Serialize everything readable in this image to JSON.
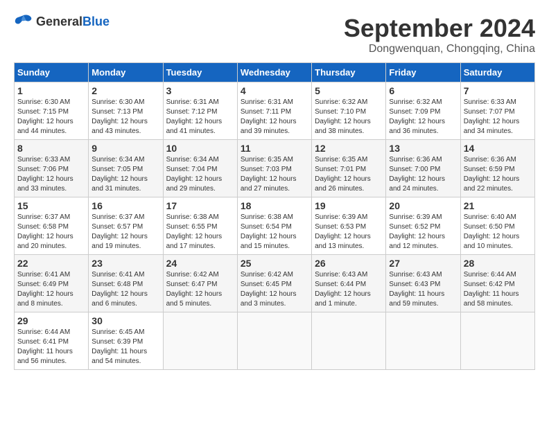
{
  "header": {
    "logo_general": "General",
    "logo_blue": "Blue",
    "month": "September 2024",
    "location": "Dongwenquan, Chongqing, China"
  },
  "days_of_week": [
    "Sunday",
    "Monday",
    "Tuesday",
    "Wednesday",
    "Thursday",
    "Friday",
    "Saturday"
  ],
  "weeks": [
    [
      {
        "day": "1",
        "sunrise": "6:30 AM",
        "sunset": "7:15 PM",
        "daylight": "12 hours and 44 minutes."
      },
      {
        "day": "2",
        "sunrise": "6:30 AM",
        "sunset": "7:13 PM",
        "daylight": "12 hours and 43 minutes."
      },
      {
        "day": "3",
        "sunrise": "6:31 AM",
        "sunset": "7:12 PM",
        "daylight": "12 hours and 41 minutes."
      },
      {
        "day": "4",
        "sunrise": "6:31 AM",
        "sunset": "7:11 PM",
        "daylight": "12 hours and 39 minutes."
      },
      {
        "day": "5",
        "sunrise": "6:32 AM",
        "sunset": "7:10 PM",
        "daylight": "12 hours and 38 minutes."
      },
      {
        "day": "6",
        "sunrise": "6:32 AM",
        "sunset": "7:09 PM",
        "daylight": "12 hours and 36 minutes."
      },
      {
        "day": "7",
        "sunrise": "6:33 AM",
        "sunset": "7:07 PM",
        "daylight": "12 hours and 34 minutes."
      }
    ],
    [
      {
        "day": "8",
        "sunrise": "6:33 AM",
        "sunset": "7:06 PM",
        "daylight": "12 hours and 33 minutes."
      },
      {
        "day": "9",
        "sunrise": "6:34 AM",
        "sunset": "7:05 PM",
        "daylight": "12 hours and 31 minutes."
      },
      {
        "day": "10",
        "sunrise": "6:34 AM",
        "sunset": "7:04 PM",
        "daylight": "12 hours and 29 minutes."
      },
      {
        "day": "11",
        "sunrise": "6:35 AM",
        "sunset": "7:03 PM",
        "daylight": "12 hours and 27 minutes."
      },
      {
        "day": "12",
        "sunrise": "6:35 AM",
        "sunset": "7:01 PM",
        "daylight": "12 hours and 26 minutes."
      },
      {
        "day": "13",
        "sunrise": "6:36 AM",
        "sunset": "7:00 PM",
        "daylight": "12 hours and 24 minutes."
      },
      {
        "day": "14",
        "sunrise": "6:36 AM",
        "sunset": "6:59 PM",
        "daylight": "12 hours and 22 minutes."
      }
    ],
    [
      {
        "day": "15",
        "sunrise": "6:37 AM",
        "sunset": "6:58 PM",
        "daylight": "12 hours and 20 minutes."
      },
      {
        "day": "16",
        "sunrise": "6:37 AM",
        "sunset": "6:57 PM",
        "daylight": "12 hours and 19 minutes."
      },
      {
        "day": "17",
        "sunrise": "6:38 AM",
        "sunset": "6:55 PM",
        "daylight": "12 hours and 17 minutes."
      },
      {
        "day": "18",
        "sunrise": "6:38 AM",
        "sunset": "6:54 PM",
        "daylight": "12 hours and 15 minutes."
      },
      {
        "day": "19",
        "sunrise": "6:39 AM",
        "sunset": "6:53 PM",
        "daylight": "12 hours and 13 minutes."
      },
      {
        "day": "20",
        "sunrise": "6:39 AM",
        "sunset": "6:52 PM",
        "daylight": "12 hours and 12 minutes."
      },
      {
        "day": "21",
        "sunrise": "6:40 AM",
        "sunset": "6:50 PM",
        "daylight": "12 hours and 10 minutes."
      }
    ],
    [
      {
        "day": "22",
        "sunrise": "6:41 AM",
        "sunset": "6:49 PM",
        "daylight": "12 hours and 8 minutes."
      },
      {
        "day": "23",
        "sunrise": "6:41 AM",
        "sunset": "6:48 PM",
        "daylight": "12 hours and 6 minutes."
      },
      {
        "day": "24",
        "sunrise": "6:42 AM",
        "sunset": "6:47 PM",
        "daylight": "12 hours and 5 minutes."
      },
      {
        "day": "25",
        "sunrise": "6:42 AM",
        "sunset": "6:45 PM",
        "daylight": "12 hours and 3 minutes."
      },
      {
        "day": "26",
        "sunrise": "6:43 AM",
        "sunset": "6:44 PM",
        "daylight": "12 hours and 1 minute."
      },
      {
        "day": "27",
        "sunrise": "6:43 AM",
        "sunset": "6:43 PM",
        "daylight": "11 hours and 59 minutes."
      },
      {
        "day": "28",
        "sunrise": "6:44 AM",
        "sunset": "6:42 PM",
        "daylight": "11 hours and 58 minutes."
      }
    ],
    [
      {
        "day": "29",
        "sunrise": "6:44 AM",
        "sunset": "6:41 PM",
        "daylight": "11 hours and 56 minutes."
      },
      {
        "day": "30",
        "sunrise": "6:45 AM",
        "sunset": "6:39 PM",
        "daylight": "11 hours and 54 minutes."
      },
      null,
      null,
      null,
      null,
      null
    ]
  ]
}
